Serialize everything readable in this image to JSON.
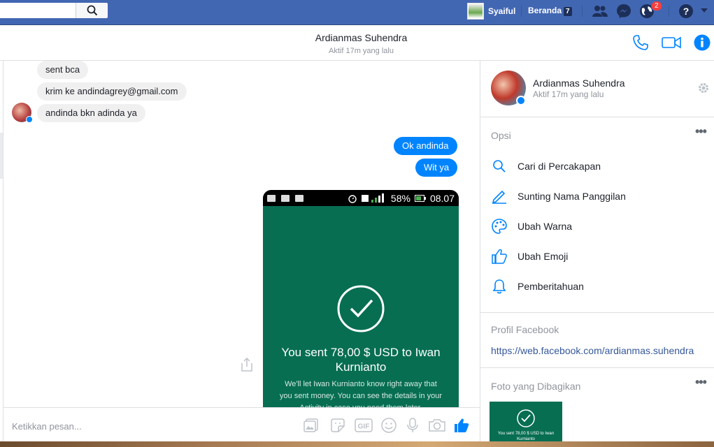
{
  "topbar": {
    "user_name": "Syaiful",
    "home_label": "Beranda",
    "home_count": "7",
    "notifications_count": "2",
    "brand_color": "#4267b2"
  },
  "conversation": {
    "name": "Ardianmas Suhendra",
    "status": "Aktif 17m yang lalu"
  },
  "messages": {
    "incoming": [
      "sent bca",
      "krim ke andindagrey@gmail.com",
      "andinda bkn adinda ya"
    ],
    "outgoing": [
      "Ok andinda",
      "Wit ya"
    ]
  },
  "screenshot": {
    "battery": "58%",
    "time": "08.07",
    "title": "You sent 78,00 $ USD to Iwan Kurnianto",
    "body": "We'll let Iwan Kurnianto know right away that you sent money. You can see the details in your Activity in case you need them later."
  },
  "composer": {
    "placeholder": "Ketikkan pesan..."
  },
  "panel": {
    "name": "Ardianmas Suhendra",
    "status": "Aktif 17m yang lalu",
    "options_heading": "Opsi",
    "options": [
      {
        "label": "Cari di Percakapan",
        "icon": "search-icon"
      },
      {
        "label": "Sunting Nama Panggilan",
        "icon": "pencil-icon"
      },
      {
        "label": "Ubah Warna",
        "icon": "palette-icon"
      },
      {
        "label": "Ubah Emoji",
        "icon": "thumbs-up-icon"
      },
      {
        "label": "Pemberitahuan",
        "icon": "bell-icon"
      }
    ],
    "profile_heading": "Profil Facebook",
    "profile_link": "https://web.facebook.com/ardianmas.suhendra",
    "shared_heading": "Foto yang Dibagikan",
    "thumb_text": "You sent 78,00 $ USD to Iwan Kurnianto"
  }
}
